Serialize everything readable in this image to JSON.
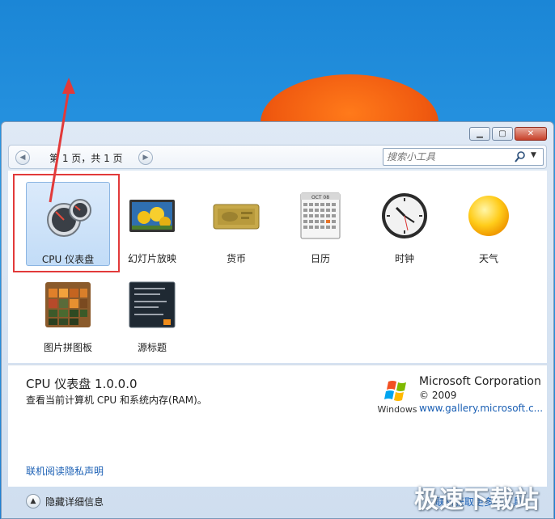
{
  "toolbar": {
    "page_label": "第 1 页，共 1 页",
    "search_placeholder": "搜索小工具"
  },
  "gadgets": [
    {
      "label": "CPU 仪表盘",
      "icon": "cpu-meter-icon",
      "selected": true
    },
    {
      "label": "幻灯片放映",
      "icon": "slideshow-icon",
      "selected": false
    },
    {
      "label": "货币",
      "icon": "currency-icon",
      "selected": false
    },
    {
      "label": "日历",
      "icon": "calendar-icon",
      "selected": false
    },
    {
      "label": "时钟",
      "icon": "clock-icon",
      "selected": false
    },
    {
      "label": "天气",
      "icon": "weather-icon",
      "selected": false
    },
    {
      "label": "图片拼图板",
      "icon": "picture-puzzle-icon",
      "selected": false
    },
    {
      "label": "源标题",
      "icon": "feed-headlines-icon",
      "selected": false
    }
  ],
  "calendar_icon_month": "OCT 08",
  "details": {
    "title": "CPU 仪表盘 1.0.0.0",
    "description": "查看当前计算机 CPU 和系统内存(RAM)。",
    "publisher": "Microsoft Corporation",
    "copyright": "© 2009",
    "link": "www.gallery.microsoft.c...",
    "windows_logo_text": "Windows",
    "privacy_link": "联机阅读隐私声明"
  },
  "footer": {
    "hide_details": "隐藏详细信息",
    "get_more": "联机获取更多小工具"
  },
  "watermark": "极速下载站",
  "colors": {
    "accent_link": "#1a5fb4",
    "selection": "#c2dcf7",
    "highlight_box": "#e23a3a",
    "close_button": "#c7402a"
  }
}
